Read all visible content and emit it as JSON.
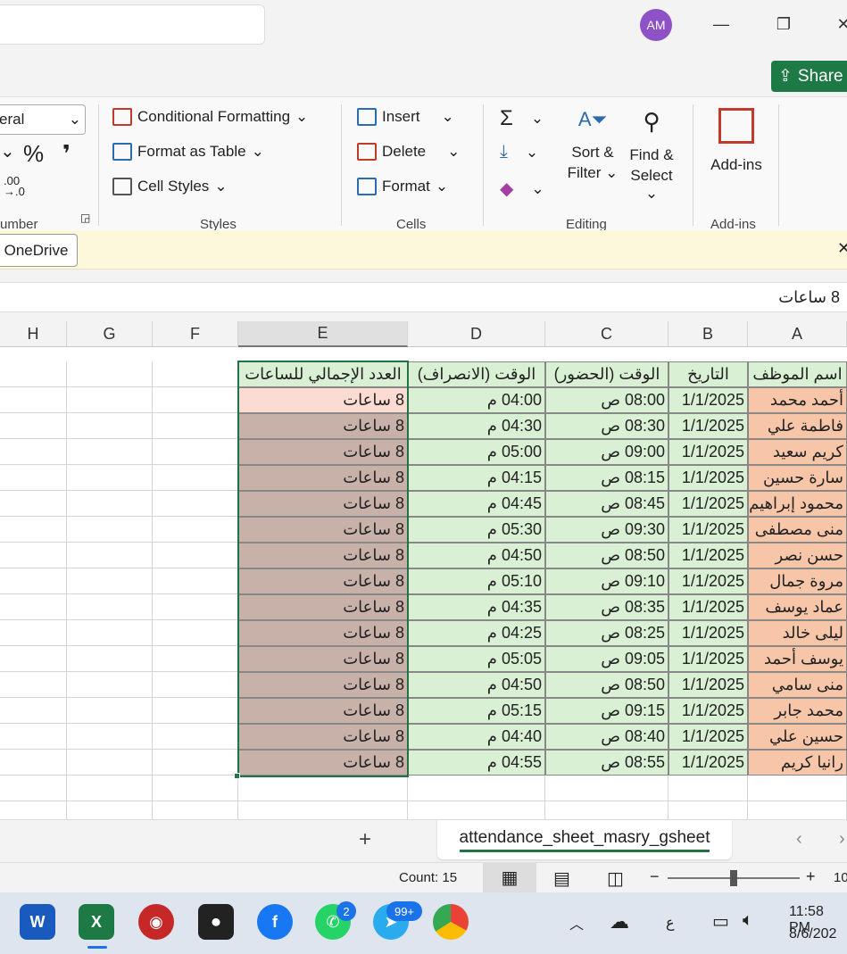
{
  "titlebar": {
    "avatar_initials": "AM",
    "minimize": "—",
    "restore": "❐",
    "close": "✕"
  },
  "share": {
    "label": "Share"
  },
  "ribbon": {
    "number_format": "eral",
    "percent": "%",
    "comma": "❜",
    "decimal": ".00\n→.0",
    "number_group": "umber",
    "conditional_formatting": "Conditional Formatting",
    "format_as_table": "Format as Table",
    "cell_styles": "Cell Styles",
    "styles_group": "Styles",
    "insert": "Insert",
    "delete": "Delete",
    "format": "Format",
    "cells_group": "Cells",
    "sort_filter_1": "Sort &",
    "sort_filter_2": "Filter",
    "find_select_1": "Find &",
    "find_select_2": "Select",
    "editing_group": "Editing",
    "addins": "Add-ins",
    "addins_group": "Add-ins"
  },
  "notice": {
    "onedrive_button": "OneDrive",
    "close": "✕"
  },
  "formula": {
    "value": "8 ساعات"
  },
  "columns": [
    "H",
    "G",
    "F",
    "E",
    "D",
    "C",
    "B",
    "A"
  ],
  "headers": {
    "a": "اسم الموظف",
    "b": "التاريخ",
    "c": "الوقت (الحضور)",
    "d": "الوقت (الانصراف)",
    "e": "العدد الإجمالي للساعات"
  },
  "rows": [
    {
      "name": "أحمد محمد",
      "date": "1/1/2025",
      "in": "08:00 ص",
      "out": "04:00 م",
      "total": "8 ساعات"
    },
    {
      "name": "فاطمة علي",
      "date": "1/1/2025",
      "in": "08:30 ص",
      "out": "04:30 م",
      "total": "8 ساعات"
    },
    {
      "name": "كريم سعيد",
      "date": "1/1/2025",
      "in": "09:00 ص",
      "out": "05:00 م",
      "total": "8 ساعات"
    },
    {
      "name": "سارة حسين",
      "date": "1/1/2025",
      "in": "08:15 ص",
      "out": "04:15 م",
      "total": "8 ساعات"
    },
    {
      "name": "محمود إبراهيم",
      "date": "1/1/2025",
      "in": "08:45 ص",
      "out": "04:45 م",
      "total": "8 ساعات"
    },
    {
      "name": "منى مصطفى",
      "date": "1/1/2025",
      "in": "09:30 ص",
      "out": "05:30 م",
      "total": "8 ساعات"
    },
    {
      "name": "حسن نصر",
      "date": "1/1/2025",
      "in": "08:50 ص",
      "out": "04:50 م",
      "total": "8 ساعات"
    },
    {
      "name": "مروة جمال",
      "date": "1/1/2025",
      "in": "09:10 ص",
      "out": "05:10 م",
      "total": "8 ساعات"
    },
    {
      "name": "عماد يوسف",
      "date": "1/1/2025",
      "in": "08:35 ص",
      "out": "04:35 م",
      "total": "8 ساعات"
    },
    {
      "name": "ليلى خالد",
      "date": "1/1/2025",
      "in": "08:25 ص",
      "out": "04:25 م",
      "total": "8 ساعات"
    },
    {
      "name": "يوسف أحمد",
      "date": "1/1/2025",
      "in": "09:05 ص",
      "out": "05:05 م",
      "total": "8 ساعات"
    },
    {
      "name": "منى سامي",
      "date": "1/1/2025",
      "in": "08:50 ص",
      "out": "04:50 م",
      "total": "8 ساعات"
    },
    {
      "name": "محمد جابر",
      "date": "1/1/2025",
      "in": "09:15 ص",
      "out": "05:15 م",
      "total": "8 ساعات"
    },
    {
      "name": "حسين علي",
      "date": "1/1/2025",
      "in": "08:40 ص",
      "out": "04:40 م",
      "total": "8 ساعات"
    },
    {
      "name": "رانيا كريم",
      "date": "1/1/2025",
      "in": "08:55 ص",
      "out": "04:55 م",
      "total": "8 ساعات"
    }
  ],
  "sheet": {
    "add": "+",
    "tab_name": "attendance_sheet_masry_gsheet"
  },
  "status": {
    "count": "Count: 15",
    "zoom_minus": "−",
    "zoom_plus": "+",
    "zoom_value": "10"
  },
  "taskbar": {
    "whatsapp_badge": "2",
    "telegram_badge": "99+",
    "keyboard_lang": "ع",
    "time": "11:58 PM",
    "date": "8/6/202"
  },
  "colors": {
    "excel_green": "#217346",
    "header_fill": "#d9f0d4",
    "name_fill": "#f7c6a9",
    "total_fill": "#c7b1a9"
  }
}
